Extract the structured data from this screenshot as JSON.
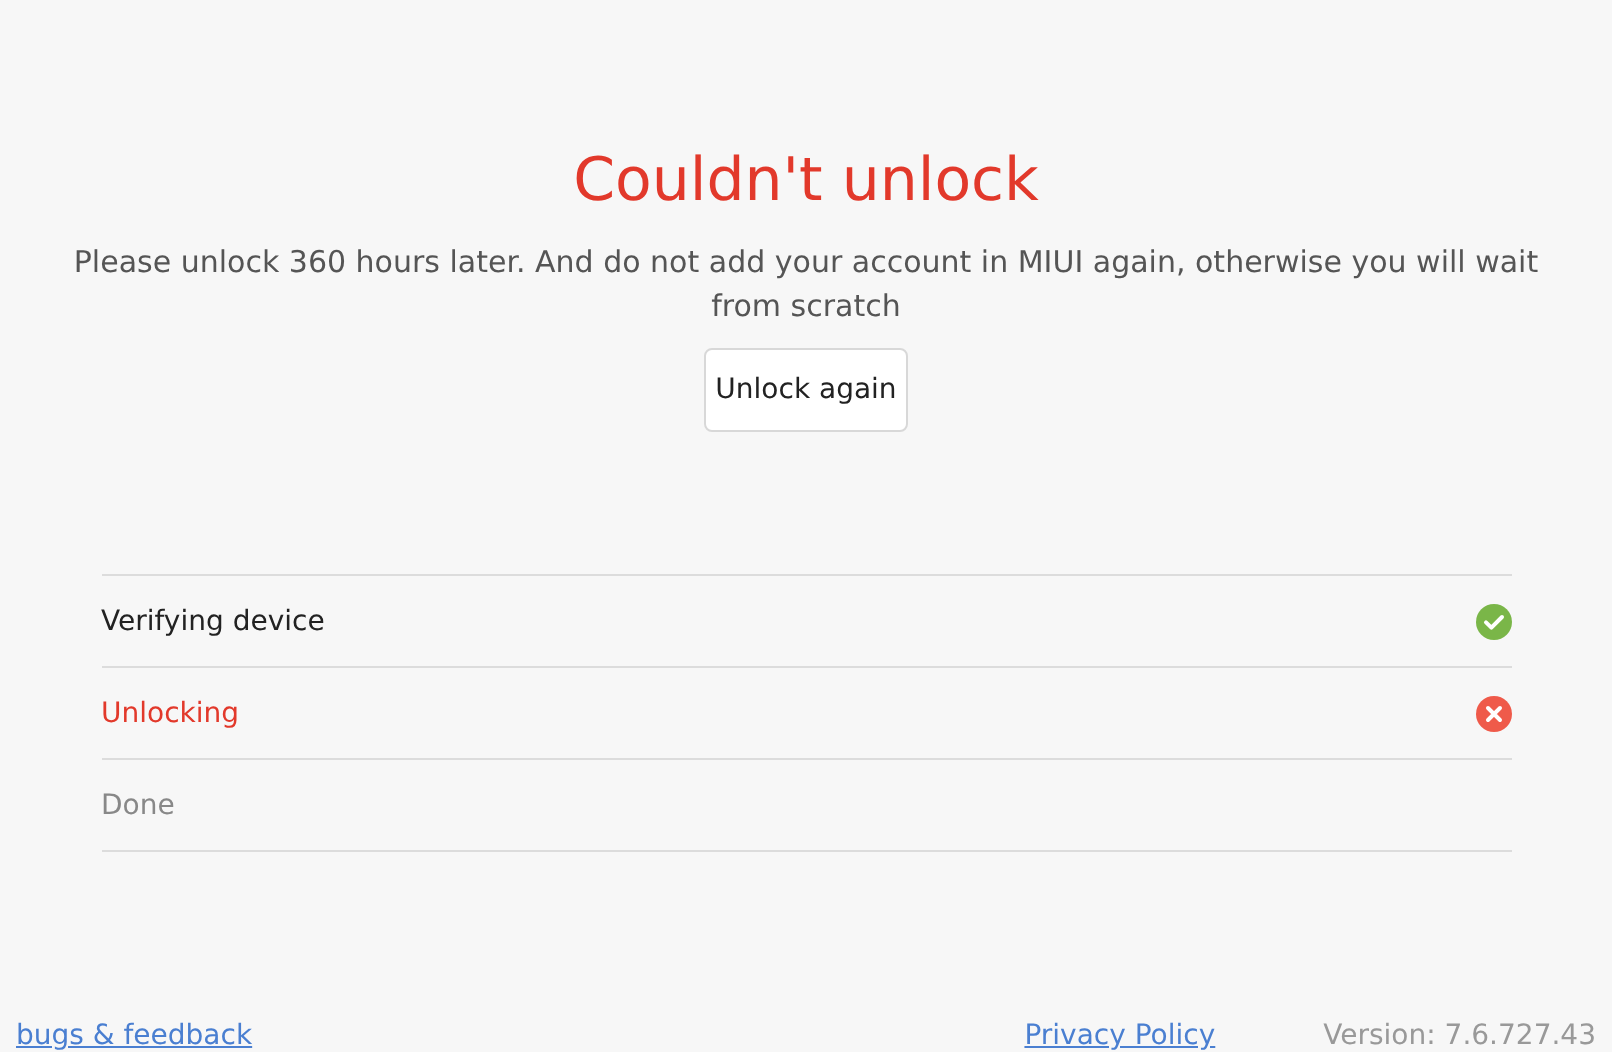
{
  "title": "Couldn't unlock",
  "message": "Please unlock 360 hours later. And do not add your account in MIUI again, otherwise you will wait from scratch",
  "action_button": "Unlock again",
  "steps": [
    {
      "label": "Verifying device",
      "kind": "success"
    },
    {
      "label": "Unlocking",
      "kind": "failed"
    },
    {
      "label": "Done",
      "kind": "pending"
    }
  ],
  "footer": {
    "feedback_link": "bugs & feedback",
    "privacy_link": "Privacy Policy",
    "version": "Version: 7.6.727.43"
  }
}
